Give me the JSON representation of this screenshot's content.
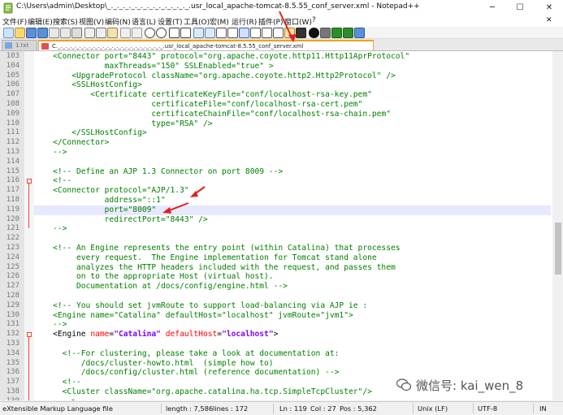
{
  "window": {
    "title": "C:\\Users\\admin\\Desktop\\_._._._._._._._._._._._._._.usr_local_apache-tomcat-8.5.55_conf_server.xml - Notepad++",
    "minimize": "─",
    "maximize": "☐",
    "close": "✕"
  },
  "menu": [
    "文件(F)",
    "编辑(E)",
    "搜索(S)",
    "视图(V)",
    "编码(N)",
    "语言(L)",
    "设置(T)",
    "工具(O)",
    "宏(M)",
    "运行(R)",
    "插件(P)",
    "窗口(W)",
    "?"
  ],
  "menu_close": "✕",
  "tabs": [
    {
      "label": "1.txt"
    },
    {
      "label": "C._._._._._._._._._._._._._._._._._._._._._._._.usr_local_apache-tomcat-8.5.55_conf_server.xml",
      "active": true
    }
  ],
  "lines": [
    {
      "n": "103",
      "segs": [
        [
          "t",
          "    <Connector "
        ],
        [
          "a",
          "port"
        ],
        [
          "t",
          "=\"8443\" "
        ],
        [
          "a",
          "protocol"
        ],
        [
          "t",
          "=\"org.apache.coyote.http11.Http11AprProtocol\""
        ]
      ]
    },
    {
      "n": "104",
      "segs": [
        [
          "t",
          "               "
        ],
        [
          "a",
          "maxThreads"
        ],
        [
          "t",
          "=\"150\" "
        ],
        [
          "a",
          "SSLEnabled"
        ],
        [
          "t",
          "=\"true\" >"
        ]
      ]
    },
    {
      "n": "105",
      "segs": [
        [
          "t",
          "        <UpgradeProtocol "
        ],
        [
          "a",
          "className"
        ],
        [
          "t",
          "=\"org.apache.coyote.http2.Http2Protocol\" />"
        ]
      ]
    },
    {
      "n": "106",
      "segs": [
        [
          "t",
          "        <SSLHostConfig>"
        ]
      ]
    },
    {
      "n": "107",
      "segs": [
        [
          "t",
          "            <Certificate "
        ],
        [
          "a",
          "certificateKeyFile"
        ],
        [
          "t",
          "=\"conf/localhost-rsa-key.pem\""
        ]
      ]
    },
    {
      "n": "108",
      "segs": [
        [
          "t",
          "                         "
        ],
        [
          "a",
          "certificateFile"
        ],
        [
          "t",
          "=\"conf/localhost-rsa-cert.pem\""
        ]
      ]
    },
    {
      "n": "109",
      "segs": [
        [
          "t",
          "                         "
        ],
        [
          "a",
          "certificateChainFile"
        ],
        [
          "t",
          "=\"conf/localhost-rsa-chain.pem\""
        ]
      ]
    },
    {
      "n": "110",
      "segs": [
        [
          "t",
          "                         "
        ],
        [
          "a",
          "type"
        ],
        [
          "t",
          "=\"RSA\" />"
        ]
      ]
    },
    {
      "n": "111",
      "segs": [
        [
          "t",
          "        </SSLHostConfig>"
        ]
      ]
    },
    {
      "n": "112",
      "segs": [
        [
          "t",
          "    </Connector>"
        ]
      ]
    },
    {
      "n": "113",
      "segs": [
        [
          "t",
          "    -->"
        ]
      ]
    },
    {
      "n": "114",
      "segs": [
        [
          "t",
          ""
        ]
      ]
    },
    {
      "n": "115",
      "segs": [
        [
          "t",
          "    <!-- Define an AJP 1.3 Connector on port 8009 -->"
        ]
      ]
    },
    {
      "n": "116",
      "segs": [
        [
          "t",
          "    <!--"
        ]
      ]
    },
    {
      "n": "117",
      "segs": [
        [
          "t",
          "    <Connector "
        ],
        [
          "a",
          "protocol"
        ],
        [
          "t",
          "=\"AJP/1.3\""
        ]
      ]
    },
    {
      "n": "118",
      "segs": [
        [
          "t",
          "               "
        ],
        [
          "a",
          "address"
        ],
        [
          "t",
          "=\"::1\""
        ]
      ]
    },
    {
      "n": "119",
      "segs": [
        [
          "t",
          "               "
        ],
        [
          "a",
          "port"
        ],
        [
          "t",
          "=\"8009\""
        ]
      ],
      "current": true
    },
    {
      "n": "120",
      "segs": [
        [
          "t",
          "               "
        ],
        [
          "a",
          "redirectPort"
        ],
        [
          "t",
          "=\"8443\" />"
        ]
      ]
    },
    {
      "n": "121",
      "segs": [
        [
          "t",
          "    -->"
        ]
      ]
    },
    {
      "n": "122",
      "segs": [
        [
          "t",
          ""
        ]
      ]
    },
    {
      "n": "123",
      "segs": [
        [
          "t",
          "    <!-- An Engine represents the entry point (within Catalina) that processes"
        ]
      ]
    },
    {
      "n": "124",
      "segs": [
        [
          "t",
          "         every request.  The Engine implementation for Tomcat stand alone"
        ]
      ]
    },
    {
      "n": "125",
      "segs": [
        [
          "t",
          "         analyzes the HTTP headers included with the request, and passes them"
        ]
      ]
    },
    {
      "n": "126",
      "segs": [
        [
          "t",
          "         on to the appropriate Host (virtual host)."
        ]
      ]
    },
    {
      "n": "127",
      "segs": [
        [
          "t",
          "         Documentation at /docs/config/engine.html -->"
        ]
      ]
    },
    {
      "n": "128",
      "segs": [
        [
          "t",
          ""
        ]
      ]
    },
    {
      "n": "129",
      "segs": [
        [
          "t",
          "    <!-- You should set jvmRoute to support load-balancing via AJP ie :"
        ]
      ]
    },
    {
      "n": "130",
      "segs": [
        [
          "t",
          "    <Engine name=\"Catalina\" defaultHost=\"localhost\" jvmRoute=\"jvm1\">"
        ]
      ]
    },
    {
      "n": "131",
      "segs": [
        [
          "t",
          "    -->"
        ]
      ]
    },
    {
      "n": "132",
      "segs": [
        [
          "g",
          "    <Engine "
        ],
        [
          "a",
          "name"
        ],
        [
          "g",
          "="
        ],
        [
          "v",
          "\"Catalina\""
        ],
        [
          "g",
          " "
        ],
        [
          "a",
          "defaultHost"
        ],
        [
          "g",
          "="
        ],
        [
          "v",
          "\"localhost\""
        ],
        [
          "g",
          ">"
        ]
      ]
    },
    {
      "n": "133",
      "segs": [
        [
          "t",
          ""
        ]
      ]
    },
    {
      "n": "134",
      "segs": [
        [
          "c",
          "      <!--For clustering, please take a look at documentation at:"
        ]
      ]
    },
    {
      "n": "135",
      "segs": [
        [
          "c",
          "          /docs/cluster-howto.html  (simple how to)"
        ]
      ]
    },
    {
      "n": "136",
      "segs": [
        [
          "c",
          "          /docs/config/cluster.html (reference documentation) -->"
        ]
      ]
    },
    {
      "n": "137",
      "segs": [
        [
          "c",
          "      <!--"
        ]
      ]
    },
    {
      "n": "138",
      "segs": [
        [
          "c",
          "      <Cluster className=\"org.apache.catalina.ha.tcp.SimpleTcpCluster\"/>"
        ]
      ]
    },
    {
      "n": "139",
      "segs": [
        [
          "c",
          "      -->"
        ]
      ]
    }
  ],
  "status": {
    "lang": "eXtensible Markup Language file",
    "length": "length : 7,586",
    "lines": "lines : 172",
    "ln": "Ln : 119",
    "col": "Col : 27",
    "pos": "Pos : 5,362",
    "eol": "Unix (LF)",
    "enc": "UTF-8",
    "ins": "IN"
  },
  "watermark": "微信号: kai_wen_8",
  "colors": {
    "arrow": "#e02020",
    "active_tab": "#f5a000",
    "fold": "#e43"
  }
}
